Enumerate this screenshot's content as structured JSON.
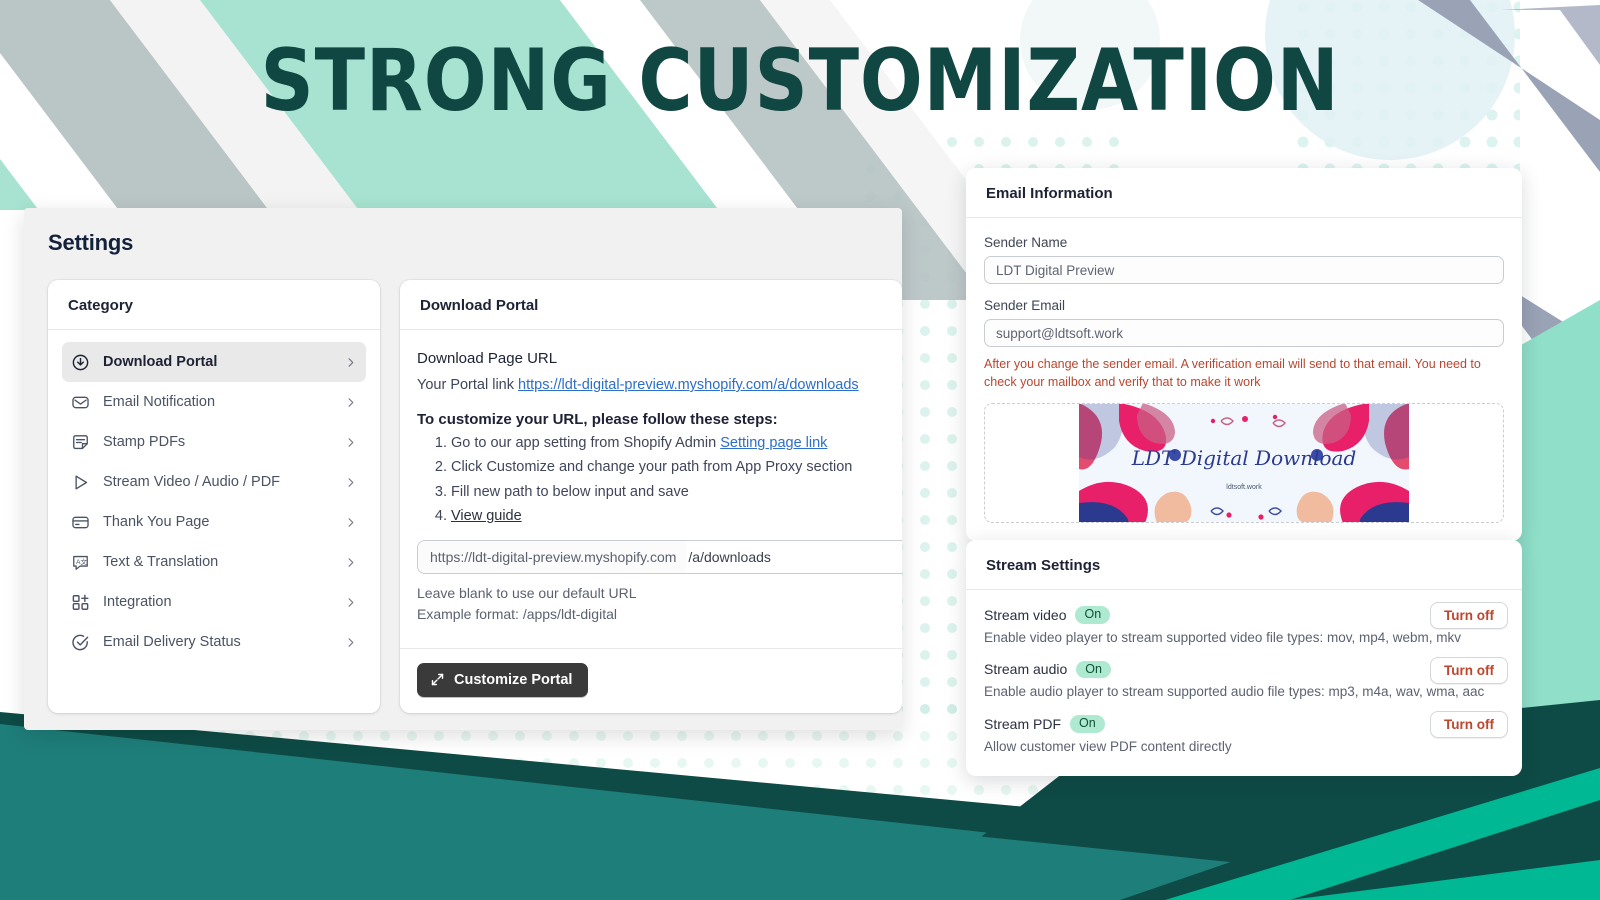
{
  "headline": "STRONG CUSTOMIZATION",
  "colors": {
    "mint": "#a7e3d0",
    "gray_stripe": "#b6c2c3",
    "blue_gray_stripe": "#9aa2b5",
    "teal_bright": "#00b894",
    "teal_mid": "#1e7e7a",
    "teal_dark": "#0e4b46",
    "headline_text": "#114743",
    "link_blue": "#2c6ecb",
    "warn_red": "#b8462f",
    "badge_green_bg": "#aee9d1",
    "button_dark": "#3a3a3a",
    "pale_blue_circle": "#ddf0f4"
  },
  "settings_window": {
    "title": "Settings",
    "category_card": {
      "heading": "Category",
      "items": [
        {
          "label": "Download Portal",
          "icon": "download-circle-icon",
          "active": true
        },
        {
          "label": "Email Notification",
          "icon": "envelope-icon",
          "active": false
        },
        {
          "label": "Stamp PDFs",
          "icon": "note-icon",
          "active": false
        },
        {
          "label": "Stream Video / Audio / PDF",
          "icon": "play-icon",
          "active": false
        },
        {
          "label": "Thank You Page",
          "icon": "credit-card-icon",
          "active": false
        },
        {
          "label": "Text & Translation",
          "icon": "translate-icon",
          "active": false
        },
        {
          "label": "Integration",
          "icon": "grid-plus-icon",
          "active": false
        },
        {
          "label": "Email Delivery Status",
          "icon": "check-circle-icon",
          "active": false
        }
      ]
    },
    "portal_card": {
      "heading": "Download Portal",
      "field_label": "Download Page URL",
      "portal_link_prefix": "Your Portal link ",
      "portal_link": "https://ldt-digital-preview.myshopify.com/a/downloads",
      "steps_title": "To customize your URL, please follow these steps:",
      "steps": [
        {
          "text": "Go to our app setting from Shopify Admin ",
          "link": "Setting page link",
          "link_style": "blue"
        },
        {
          "text": "Click Customize and change your path from App Proxy section",
          "link": "",
          "link_style": ""
        },
        {
          "text": "Fill new path to below input and save",
          "link": "",
          "link_style": ""
        },
        {
          "text": "",
          "link": "View guide",
          "link_style": "plain"
        }
      ],
      "url_input_prefix": "https://ldt-digital-preview.myshopify.com",
      "url_input_value": "/a/downloads",
      "hint_line_1": "Leave blank to use our default URL",
      "hint_line_2": "Example format: /apps/ldt-digital",
      "customize_button": "Customize Portal",
      "customize_button_icon": "expand-arrows-icon"
    }
  },
  "email_card": {
    "heading": "Email Information",
    "sender_name_label": "Sender Name",
    "sender_name_value": "LDT Digital Preview",
    "sender_email_label": "Sender Email",
    "sender_email_value": "support@ldtsoft.work",
    "warning": "After you change the sender email. A verification email will send to that email. You need to check your mailbox and verify that to make it work",
    "banner": {
      "title": "LDT Digital Download",
      "subtitle": "ldtsoft.work"
    }
  },
  "stream_card": {
    "heading": "Stream Settings",
    "rows": [
      {
        "name": "Stream video",
        "state": "On",
        "description": "Enable video player to stream supported video file types: mov, mp4, webm, mkv",
        "action": "Turn off"
      },
      {
        "name": "Stream audio",
        "state": "On",
        "description": "Enable audio player to stream supported audio file types: mp3, m4a, wav, wma, aac",
        "action": "Turn off"
      },
      {
        "name": "Stream PDF",
        "state": "On",
        "description": "Allow customer view PDF content directly",
        "action": "Turn off"
      }
    ]
  }
}
